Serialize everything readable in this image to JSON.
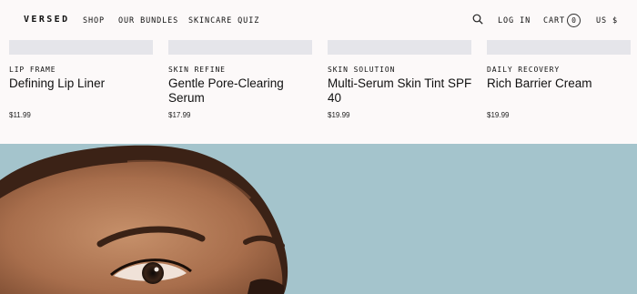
{
  "nav": {
    "logo": "VERSED",
    "links": [
      "SHOP",
      "OUR BUNDLES",
      "SKINCARE QUIZ"
    ],
    "login": "LOG IN",
    "cart_label": "CART",
    "cart_count": "0",
    "currency": "US $",
    "search_icon": "search-icon"
  },
  "products": [
    {
      "category": "LIP FRAME",
      "name": "Defining Lip Liner",
      "price": "$11.99"
    },
    {
      "category": "SKIN REFINE",
      "name": "Gentle Pore-Clearing Serum",
      "price": "$17.99"
    },
    {
      "category": "SKIN SOLUTION",
      "name": "Multi-Serum Skin Tint SPF 40",
      "price": "$19.99"
    },
    {
      "category": "DAILY RECOVERY",
      "name": "Rich Barrier Cream",
      "price": "$19.99"
    }
  ],
  "colors": {
    "page_background": "#fcf9f9",
    "hero_background": "#a4c4cc",
    "product_image_placeholder": "#e5e5ea"
  }
}
